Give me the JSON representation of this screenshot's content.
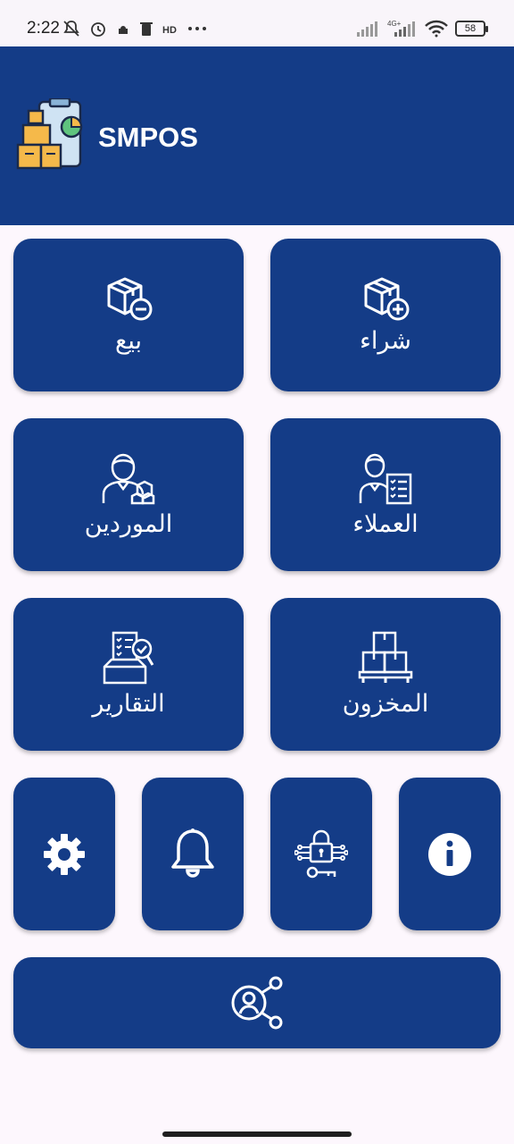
{
  "status_bar": {
    "time": "2:22",
    "battery": "58",
    "network": "4G+"
  },
  "header": {
    "title": "SMPOS"
  },
  "tiles": {
    "sell": {
      "label": "بيع"
    },
    "buy": {
      "label": "شراء"
    },
    "suppliers": {
      "label": "الموردين"
    },
    "customers": {
      "label": "العملاء"
    },
    "reports": {
      "label": "التقارير"
    },
    "inventory": {
      "label": "المخزون"
    }
  },
  "icons": {
    "settings": "gear-icon",
    "notifications": "bell-icon",
    "security": "lock-circuit-icon",
    "info": "info-icon",
    "share": "user-share-icon"
  },
  "colors": {
    "primary": "#143c87",
    "background": "#fdf7fd",
    "on_primary": "#ffffff"
  }
}
